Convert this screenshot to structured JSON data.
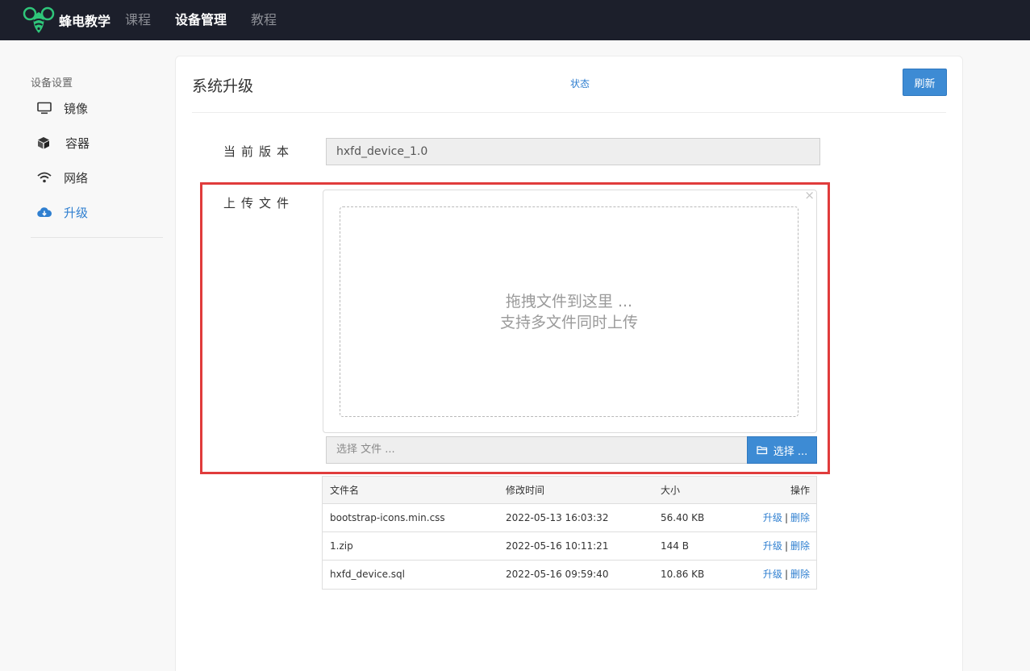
{
  "navbar": {
    "brand": "蜂电教学",
    "items": [
      {
        "label": "课程",
        "active": false
      },
      {
        "label": "设备管理",
        "active": true
      },
      {
        "label": "教程",
        "active": false
      }
    ]
  },
  "sidebar": {
    "title": "设备设置",
    "items": [
      {
        "label": "镜像",
        "icon": "monitor-icon"
      },
      {
        "label": "容器",
        "icon": "box-icon"
      },
      {
        "label": "网络",
        "icon": "wifi-icon"
      },
      {
        "label": "升级",
        "icon": "cloud-download-icon",
        "active": true
      }
    ]
  },
  "main": {
    "title": "系统升级",
    "status_link": "状态",
    "refresh_label": "刷新",
    "current_version_label": "当前版本",
    "current_version_value": "hxfd_device_1.0",
    "upload_label": "上传文件",
    "dropzone": {
      "line1": "拖拽文件到这里 ...",
      "line2": "支持多文件同时上传",
      "close": "×"
    },
    "file_input_placeholder": "选择 文件 ...",
    "choose_label": "选择 ..."
  },
  "table": {
    "headers": [
      "文件名",
      "修改时间",
      "大小",
      "操作"
    ],
    "rows": [
      {
        "name": "bootstrap-icons.min.css",
        "time": "2022-05-13 16:03:32",
        "size": "56.40 KB",
        "upgrade": "升级",
        "sep": "|",
        "delete": "删除"
      },
      {
        "name": "1.zip",
        "time": "2022-05-16 10:11:21",
        "size": "144 B",
        "upgrade": "升级",
        "sep": "|",
        "delete": "删除"
      },
      {
        "name": "hxfd_device.sql",
        "time": "2022-05-16 09:59:40",
        "size": "10.86 KB",
        "upgrade": "升级",
        "sep": "|",
        "delete": "删除"
      }
    ]
  },
  "colors": {
    "navbar_bg": "#1c1f2b",
    "accent": "#3d8bd4",
    "highlight_frame": "#e03c3c"
  }
}
